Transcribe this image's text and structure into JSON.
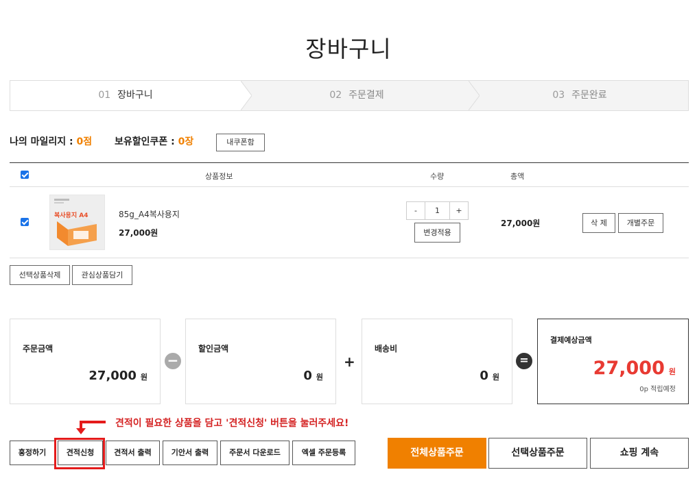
{
  "page": {
    "title": "장바구니"
  },
  "steps": [
    {
      "num": "01",
      "label": "장바구니"
    },
    {
      "num": "02",
      "label": "주문결제"
    },
    {
      "num": "03",
      "label": "주문완료"
    }
  ],
  "mileage": {
    "label": "나의 마일리지 : ",
    "value": "0점"
  },
  "coupon": {
    "label": "보유할인쿠폰 : ",
    "value": "0장",
    "button": "내쿠폰함"
  },
  "table": {
    "headers": {
      "product": "상품정보",
      "qty": "수량",
      "total": "총액"
    }
  },
  "item": {
    "name": "85g_A4복사용지",
    "price": "27,000원",
    "qty": "1",
    "qty_minus": "-",
    "qty_plus": "+",
    "apply": "변경적용",
    "total": "27,000원",
    "delete": "삭 제",
    "single_order": "개별주문",
    "thumb_text": "복사용지 A4"
  },
  "list_actions": {
    "delete_selected": "선택상품삭제",
    "add_wishlist": "관심상품담기"
  },
  "summary": {
    "order_label": "주문금액",
    "order_value": "27,000",
    "discount_label": "할인금액",
    "discount_value": "0",
    "shipping_label": "배송비",
    "shipping_value": "0",
    "expected_label": "결제예상금액",
    "expected_value": "27,000",
    "won": "원",
    "points": "0p 적립예정",
    "op_minus": "−",
    "op_plus": "+",
    "op_eq": "="
  },
  "hint": "견적이 필요한 상품을 담고 '견적신청' 버튼을 눌러주세요!",
  "bottom": {
    "share": "홍정하기",
    "quote_request": "견적신청",
    "quote_print": "견적서 출력",
    "proposal_print": "기안서 출력",
    "order_download": "주문서 다운로드",
    "excel_order": "엑셀 주문등록",
    "order_all": "전체상품주문",
    "order_selected": "선택상품주문",
    "continue": "쇼핑 계속"
  },
  "colors": {
    "accent": "#f08000",
    "price_red": "#e83a32",
    "highlight": "#e41b1b",
    "check": "#1a73e8"
  }
}
